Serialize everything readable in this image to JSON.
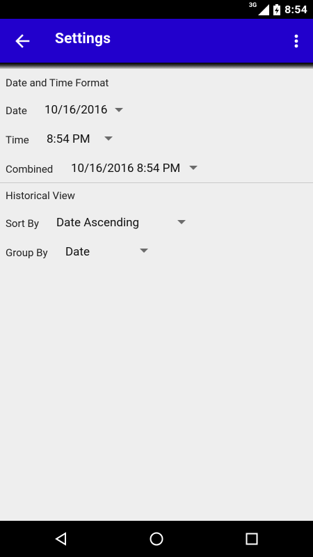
{
  "status_bar": {
    "network": "3G",
    "time": "8:54",
    "icons": [
      "signal-icon",
      "battery-icon"
    ]
  },
  "app_bar": {
    "title": "Settings",
    "back_icon": "arrow-back-icon",
    "menu_icon": "more-vert-icon",
    "color": "#2200cc"
  },
  "date_time_format": {
    "section_title": "Date and Time Format",
    "date": {
      "label": "Date",
      "value": "10/16/2016"
    },
    "time": {
      "label": "Time",
      "value": "8:54 PM"
    },
    "combined": {
      "label": "Combined",
      "value": "10/16/2016 8:54 PM"
    }
  },
  "historical_view": {
    "section_title": "Historical View",
    "sort_by": {
      "label": "Sort By",
      "value": "Date Ascending"
    },
    "group_by": {
      "label": "Group By",
      "value": "Date"
    }
  },
  "nav_bar": {
    "icons": [
      "back-triangle-icon",
      "home-circle-icon",
      "recents-square-icon"
    ]
  }
}
